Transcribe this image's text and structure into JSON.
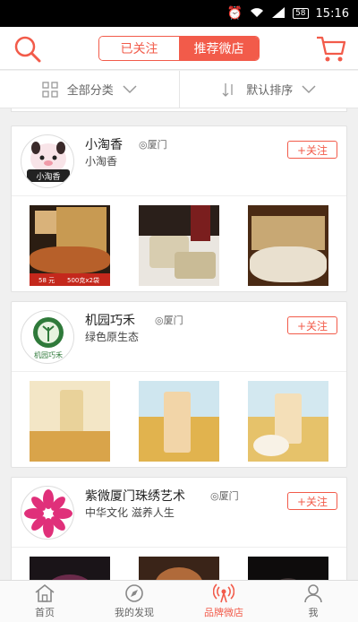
{
  "status": {
    "time": "15:16",
    "battery": "58"
  },
  "header": {
    "tabs": [
      {
        "label": "已关注",
        "active": false
      },
      {
        "label": "推荐微店",
        "active": true
      }
    ],
    "accent": "#f25b4a"
  },
  "filters": {
    "category": "全部分类",
    "sort": "默认排序"
  },
  "shops": [
    {
      "name": "小淘香",
      "location": "厦门",
      "desc": "小淘香",
      "follow": "+关注",
      "logo_text": "小淘香",
      "badge_a": "58 元",
      "badge_b": "500克x2袋"
    },
    {
      "name": "机园巧禾",
      "location": "厦门",
      "desc": "绿色原生态",
      "follow": "+关注",
      "logo_text": "机园巧禾"
    },
    {
      "name": "紫微厦门珠绣艺术",
      "location": "厦门",
      "desc": "中华文化 滋养人生",
      "follow": "+关注"
    }
  ],
  "nav": [
    {
      "label": "首页",
      "icon": "home-icon"
    },
    {
      "label": "我的发现",
      "icon": "compass-icon"
    },
    {
      "label": "品牌微店",
      "icon": "broadcast-icon",
      "active": true
    },
    {
      "label": "我",
      "icon": "user-icon"
    }
  ]
}
